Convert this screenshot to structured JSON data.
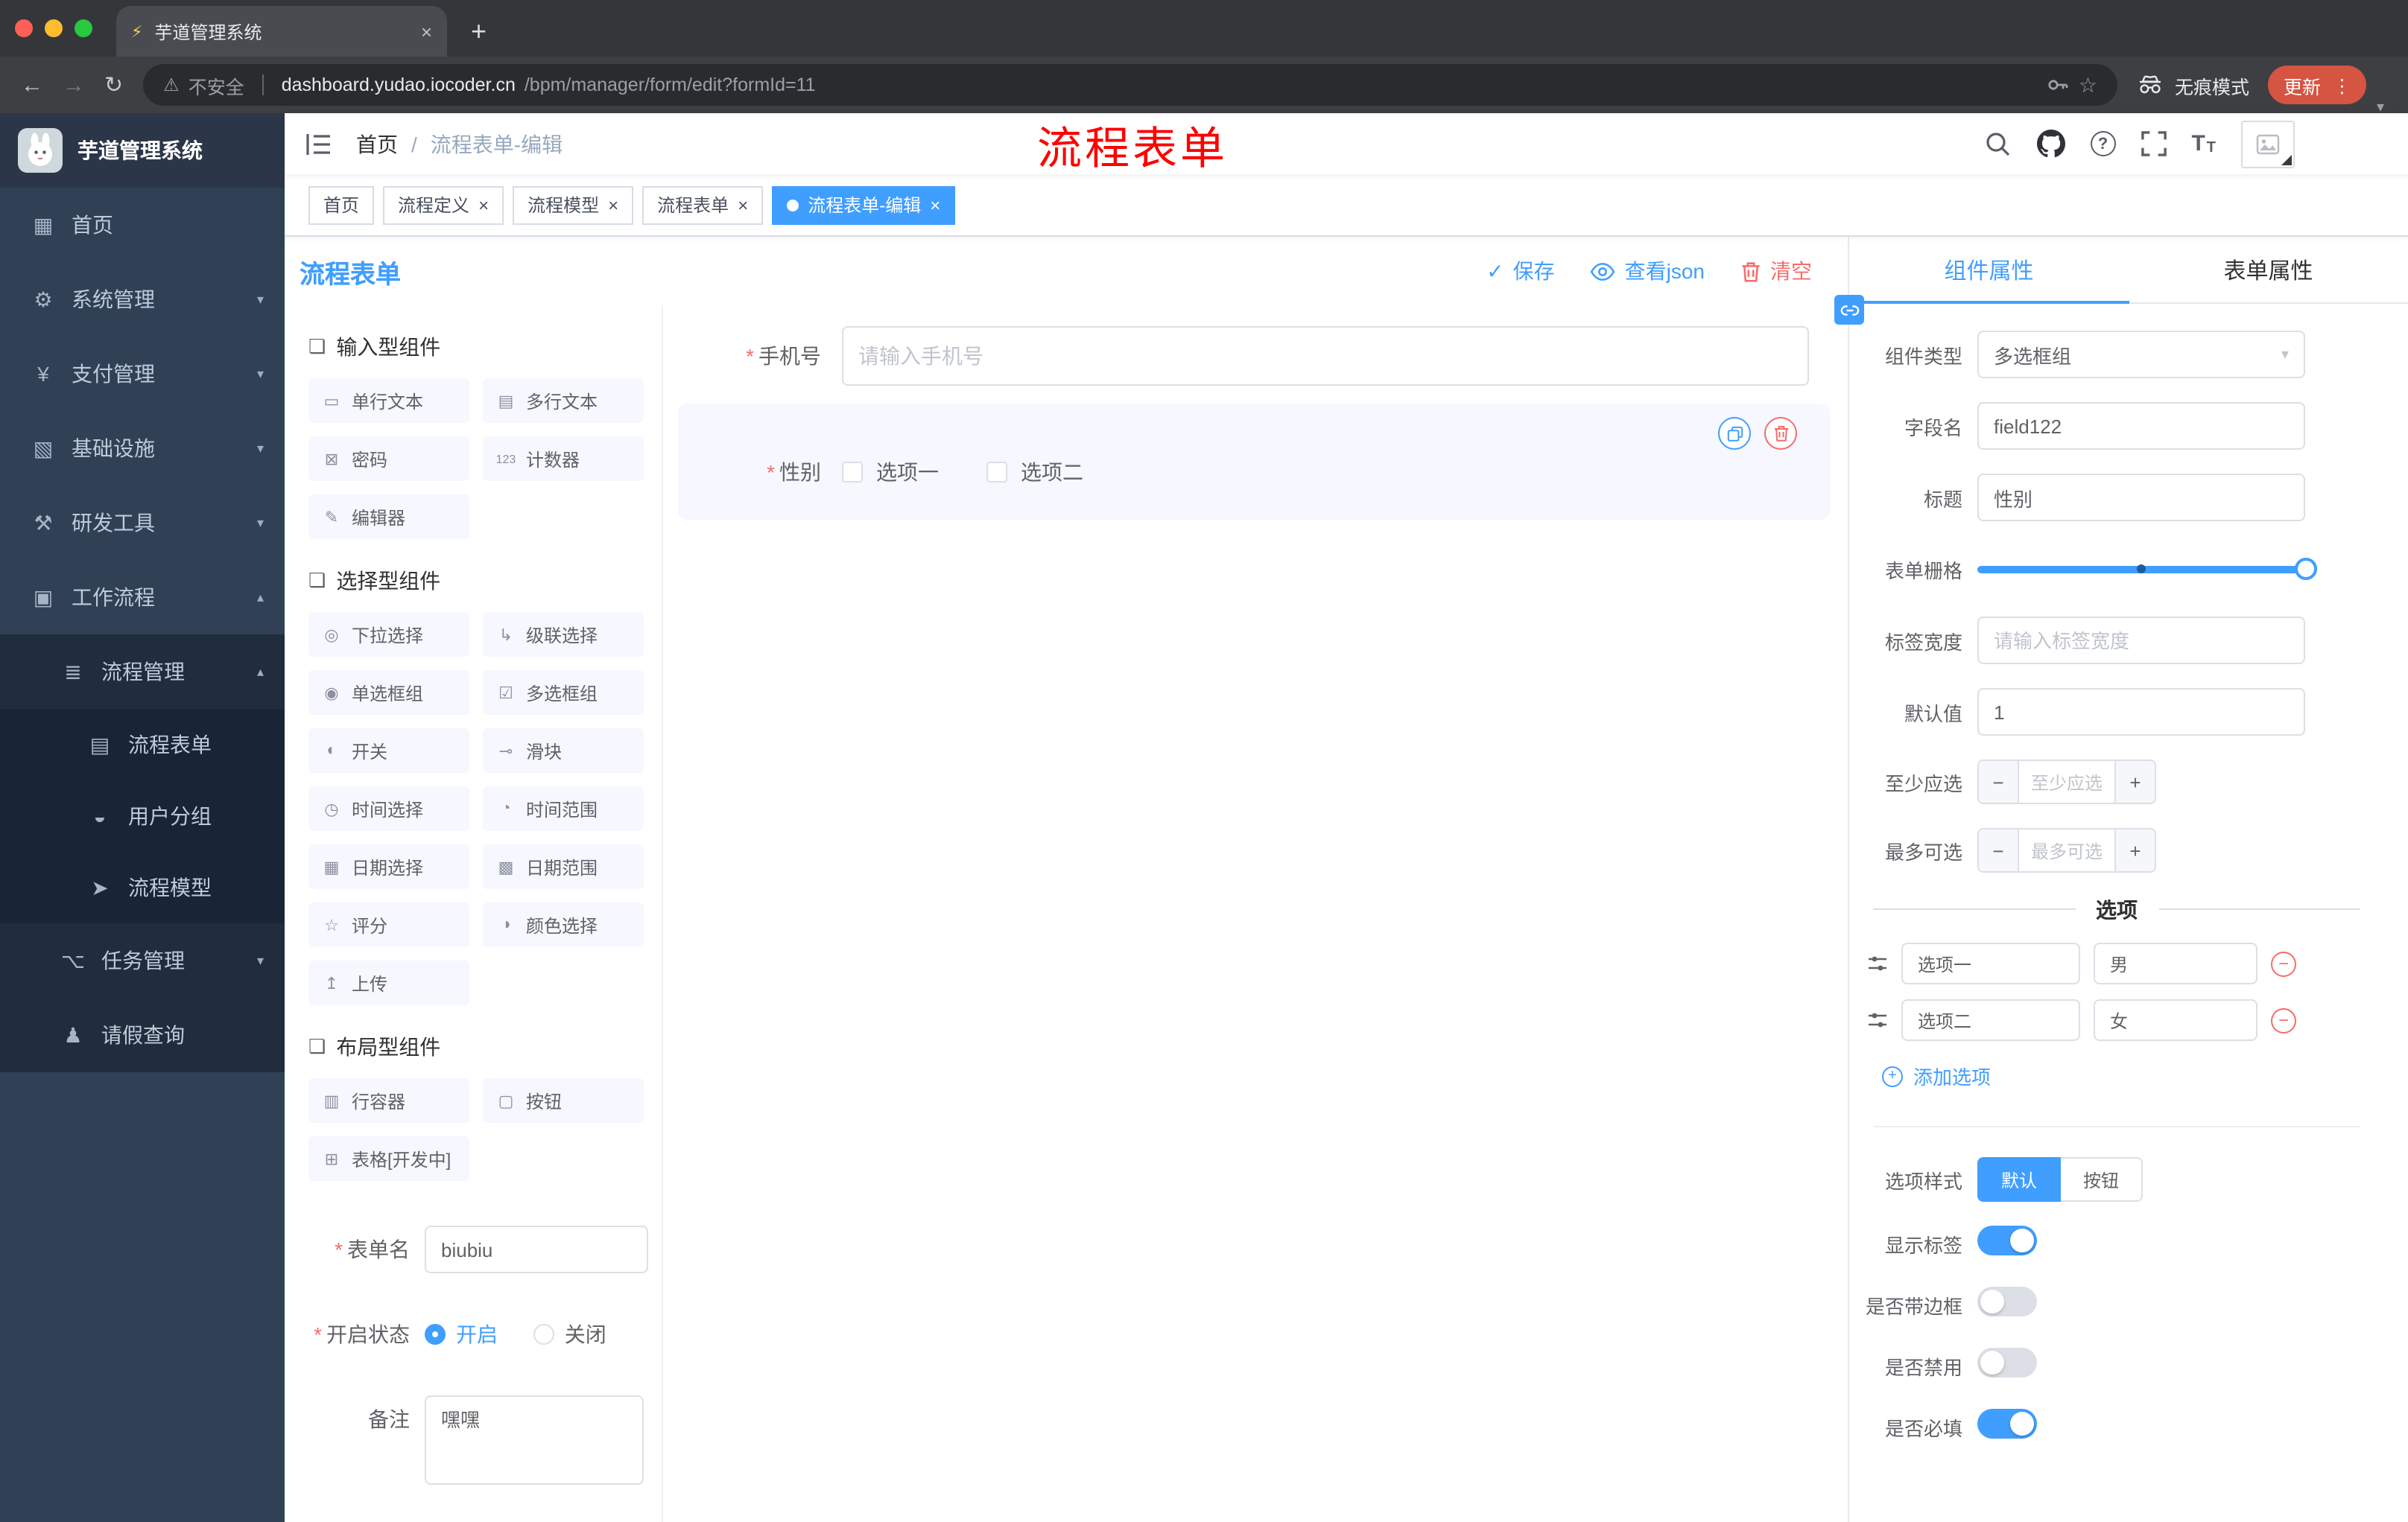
{
  "colors": {
    "primary": "#409EFF",
    "danger": "#F56C6C",
    "sidebar_bg": "#304156"
  },
  "ui": {
    "close": "×",
    "plus": "+",
    "dots": "⋮",
    "star": "☆",
    "warning": "⚠",
    "back": "←",
    "forward": "→",
    "reload": "↻",
    "minus": "−",
    "chevron_down": "▾",
    "chevron_up": "▴",
    "check": "✓",
    "slash": "/",
    "question": "?",
    "font_big": "T",
    "font_small": "T"
  },
  "browser": {
    "tab_title": "芋道管理系统",
    "security_label": "不安全",
    "url_host": "dashboard.yudao.iocoder.cn",
    "url_path": "/bpm/manager/form/edit?formId=11",
    "incognito_label": "无痕模式",
    "update_label": "更新"
  },
  "sidebar": {
    "title": "芋道管理系统",
    "menu": [
      {
        "label": "首页",
        "icon": "▦"
      },
      {
        "label": "系统管理",
        "icon": "⚙"
      },
      {
        "label": "支付管理",
        "icon": "¥"
      },
      {
        "label": "基础设施",
        "icon": "▧"
      },
      {
        "label": "研发工具",
        "icon": "⚒"
      },
      {
        "label": "工作流程",
        "icon": "▣"
      }
    ],
    "process_mgmt": {
      "label": "流程管理",
      "icon": "≣"
    },
    "process_children": [
      {
        "label": "流程表单",
        "icon": "▤"
      },
      {
        "label": "用户分组",
        "icon": "◒"
      },
      {
        "label": "流程模型",
        "icon": "➤"
      }
    ],
    "task_mgmt": {
      "label": "任务管理",
      "icon": "⌥"
    },
    "leave_query": {
      "label": "请假查询",
      "icon": "♟"
    }
  },
  "header": {
    "breadcrumb_home": "首页",
    "breadcrumb_current": "流程表单-编辑",
    "annotation": "流程表单"
  },
  "tags": [
    {
      "label": "首页"
    },
    {
      "label": "流程定义"
    },
    {
      "label": "流程模型"
    },
    {
      "label": "流程表单"
    },
    {
      "label": "流程表单-编辑"
    }
  ],
  "designer": {
    "title": "流程表单",
    "save": "保存",
    "view_json": "查看json",
    "clear": "清空"
  },
  "palette": {
    "groups": [
      {
        "title": "输入型组件",
        "icon": "❏",
        "items": [
          {
            "label": "单行文本",
            "icon": "▭"
          },
          {
            "label": "多行文本",
            "icon": "▤"
          },
          {
            "label": "密码",
            "icon": "⊠"
          },
          {
            "label": "计数器",
            "icon": "123"
          },
          {
            "label": "编辑器",
            "icon": "✎"
          }
        ]
      },
      {
        "title": "选择型组件",
        "icon": "❏",
        "items": [
          {
            "label": "下拉选择",
            "icon": "◎"
          },
          {
            "label": "级联选择",
            "icon": "↳"
          },
          {
            "label": "单选框组",
            "icon": "◉"
          },
          {
            "label": "多选框组",
            "icon": "☑"
          },
          {
            "label": "开关",
            "icon": "◐"
          },
          {
            "label": "滑块",
            "icon": "⊸"
          },
          {
            "label": "时间选择",
            "icon": "◷"
          },
          {
            "label": "时间范围",
            "icon": "◔"
          },
          {
            "label": "日期选择",
            "icon": "▦"
          },
          {
            "label": "日期范围",
            "icon": "▩"
          },
          {
            "label": "评分",
            "icon": "☆"
          },
          {
            "label": "颜色选择",
            "icon": "◑"
          },
          {
            "label": "上传",
            "icon": "↥"
          }
        ]
      },
      {
        "title": "布局型组件",
        "icon": "❏",
        "items": [
          {
            "label": "行容器",
            "icon": "▥"
          },
          {
            "label": "按钮",
            "icon": "▢"
          },
          {
            "label": "表格[开发中]",
            "icon": "⊞"
          }
        ]
      }
    ],
    "meta": {
      "name_label": "表单名",
      "name_value": "biubiu",
      "status_label": "开启状态",
      "status_on": "开启",
      "status_off": "关闭",
      "remark_label": "备注",
      "remark_value": "嘿嘿"
    }
  },
  "canvas": {
    "phone_label": "手机号",
    "phone_placeholder": "请输入手机号",
    "gender_label": "性别",
    "gender_opt1": "选项一",
    "gender_opt2": "选项二"
  },
  "props": {
    "tab_component": "组件属性",
    "tab_form": "表单属性",
    "type_label": "组件类型",
    "type_value": "多选框组",
    "field_label": "字段名",
    "field_value": "field122",
    "title_label": "标题",
    "title_value": "性别",
    "grid_label": "表单栅格",
    "width_label": "标签宽度",
    "width_placeholder": "请输入标签宽度",
    "default_label": "默认值",
    "default_value": "1",
    "min_label": "至少应选",
    "min_placeholder": "至少应选",
    "max_label": "最多可选",
    "max_placeholder": "最多可选",
    "options_title": "选项",
    "options": [
      {
        "label": "选项一",
        "value": "男"
      },
      {
        "label": "选项二",
        "value": "女"
      }
    ],
    "add_option": "添加选项",
    "style_label": "选项样式",
    "style_default": "默认",
    "style_button": "按钮",
    "sw_show_label": "显示标签",
    "sw_border": "是否带边框",
    "sw_disabled": "是否禁用",
    "sw_required": "是否必填"
  }
}
